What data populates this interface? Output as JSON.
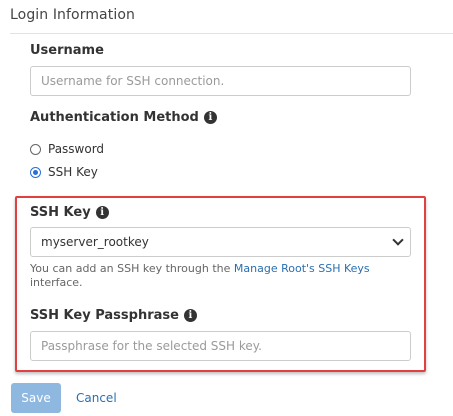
{
  "section": {
    "title": "Login Information"
  },
  "username": {
    "label": "Username",
    "placeholder": "Username for SSH connection.",
    "value": ""
  },
  "auth_method": {
    "label": "Authentication Method",
    "info_icon": "info-circle-icon",
    "options": [
      {
        "label": "Password",
        "selected": false
      },
      {
        "label": "SSH Key",
        "selected": true
      }
    ]
  },
  "ssh_key": {
    "label": "SSH Key",
    "info_icon": "info-circle-icon",
    "selected_value": "myserver_rootkey",
    "help_prefix": "You can add an SSH key through the ",
    "help_link": "Manage Root's SSH Keys",
    "help_suffix": " interface."
  },
  "passphrase": {
    "label": "SSH Key Passphrase",
    "info_icon": "info-circle-icon",
    "placeholder": "Passphrase for the selected SSH key.",
    "value": ""
  },
  "actions": {
    "save_label": "Save",
    "cancel_label": "Cancel"
  },
  "colors": {
    "highlight_border": "#e04040",
    "link": "#2a6fb0",
    "save_button_bg": "#8fb8e0",
    "radio_selected": "#2a6fd6"
  }
}
